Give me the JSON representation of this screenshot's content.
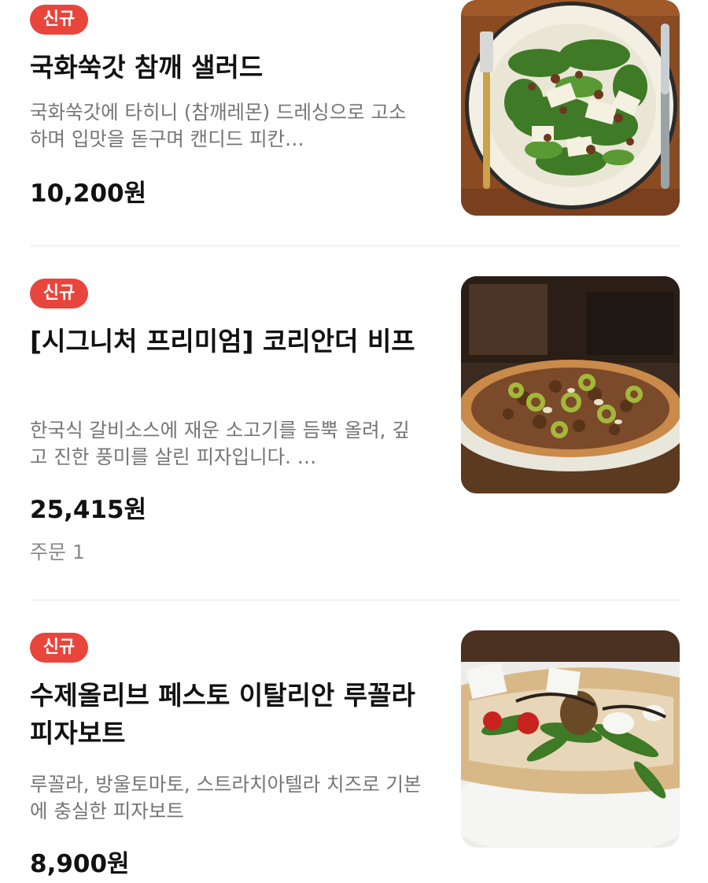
{
  "menu": {
    "items": [
      {
        "badge": "신규",
        "name": "국화쑥갓 참깨 샐러드",
        "description": "국화쑥갓에 타히니 (참깨레몬) 드레싱으로 고소하며 입맛을 돋구며 캔디드 피칸…",
        "price": "10,200원",
        "image_icon": "salad-photo"
      },
      {
        "badge": "신규",
        "name": "[시그니처 프리미엄] 코리안더 비프",
        "description": "한국식 갈비소스에 재운 소고기를 듬뿍 올려, 깊고 진한 풍미를 살린 피자입니다. …",
        "price": "25,415원",
        "orders": "주문 1",
        "image_icon": "pizza-photo"
      },
      {
        "badge": "신규",
        "name": "수제올리브 페스토 이탈리안 루꼴라 피자보트",
        "description": "루꼴라, 방울토마토, 스트라치아텔라 치즈로 기본에 충실한 피자보트",
        "price": "8,900원",
        "image_icon": "pizza-boat-photo"
      }
    ]
  }
}
